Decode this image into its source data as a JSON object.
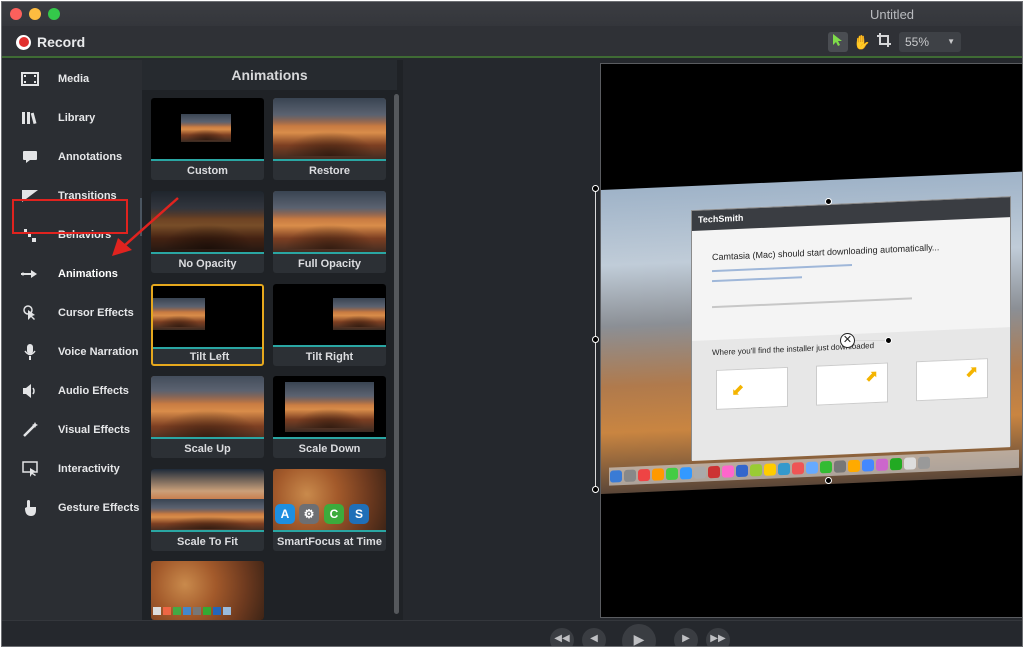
{
  "window": {
    "title": "Untitled"
  },
  "toolbar": {
    "record_label": "Record",
    "zoom_value": "55%",
    "tools": [
      "select-arrow-icon",
      "hand-pan-icon",
      "crop-icon"
    ]
  },
  "sidebar": {
    "items": [
      {
        "label": "Media",
        "icon": "film-icon"
      },
      {
        "label": "Library",
        "icon": "library-books-icon"
      },
      {
        "label": "Annotations",
        "icon": "speech-bubble-icon"
      },
      {
        "label": "Transitions",
        "icon": "transition-icon"
      },
      {
        "label": "Behaviors",
        "icon": "behaviors-icon"
      },
      {
        "label": "Animations",
        "icon": "animation-arrow-icon",
        "active": true
      },
      {
        "label": "Cursor Effects",
        "icon": "cursor-icon"
      },
      {
        "label": "Voice Narration",
        "icon": "microphone-icon"
      },
      {
        "label": "Audio Effects",
        "icon": "speaker-icon"
      },
      {
        "label": "Visual Effects",
        "icon": "magic-wand-icon"
      },
      {
        "label": "Interactivity",
        "icon": "interactivity-icon"
      },
      {
        "label": "Gesture Effects",
        "icon": "hand-gesture-icon"
      }
    ]
  },
  "animations_panel": {
    "title": "Animations",
    "tiles": [
      {
        "label": "Custom"
      },
      {
        "label": "Restore"
      },
      {
        "label": "No Opacity"
      },
      {
        "label": "Full Opacity"
      },
      {
        "label": "Tilt Left",
        "selected": true
      },
      {
        "label": "Tilt Right"
      },
      {
        "label": "Scale Up"
      },
      {
        "label": "Scale Down"
      },
      {
        "label": "Scale To Fit"
      },
      {
        "label": "SmartFocus at Time"
      },
      {
        "label": ""
      }
    ]
  },
  "canvas": {
    "preview": {
      "brand": "TechSmith",
      "heading": "Camtasia (Mac) should start downloading automatically...",
      "subheading": "Where you'll find the installer just downloaded"
    }
  },
  "colors": {
    "accent_teal": "#2aa6a3",
    "selected_border": "#e6a81d",
    "annotation_red": "#e0231f",
    "record_red": "#e2302f"
  }
}
